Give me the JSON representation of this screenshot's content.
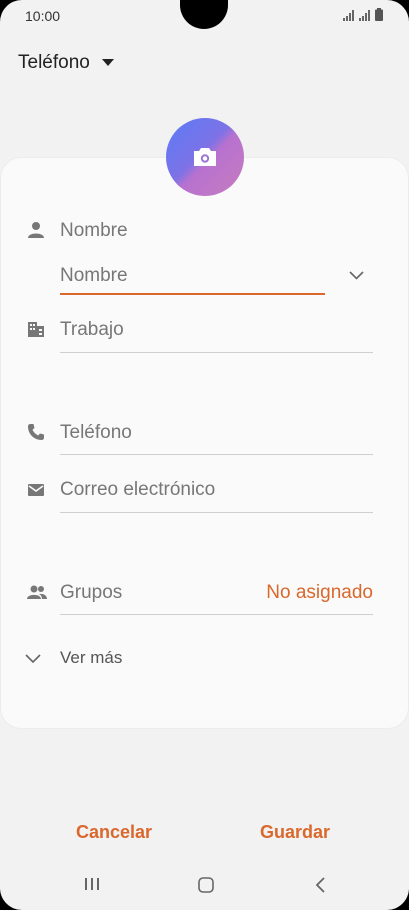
{
  "status_bar": {
    "time": "10:00"
  },
  "header": {
    "account_label": "Teléfono"
  },
  "fields": {
    "name_label": "Nombre",
    "name_input_placeholder": "Nombre",
    "work_placeholder": "Trabajo",
    "phone_placeholder": "Teléfono",
    "email_placeholder": "Correo electrónico",
    "groups_label": "Grupos",
    "groups_value": "No asignado",
    "more_label": "Ver más"
  },
  "footer": {
    "cancel_label": "Cancelar",
    "save_label": "Guardar"
  },
  "colors": {
    "accent": "#d9682c",
    "background": "#f2f2f2",
    "card": "#fafafa"
  },
  "icons": [
    "signal-icon",
    "battery-icon",
    "dropdown-arrow-icon",
    "camera-icon",
    "person-icon",
    "building-icon",
    "phone-icon",
    "email-icon",
    "group-icon",
    "chevron-down-icon",
    "recents-icon",
    "home-icon",
    "back-icon"
  ]
}
